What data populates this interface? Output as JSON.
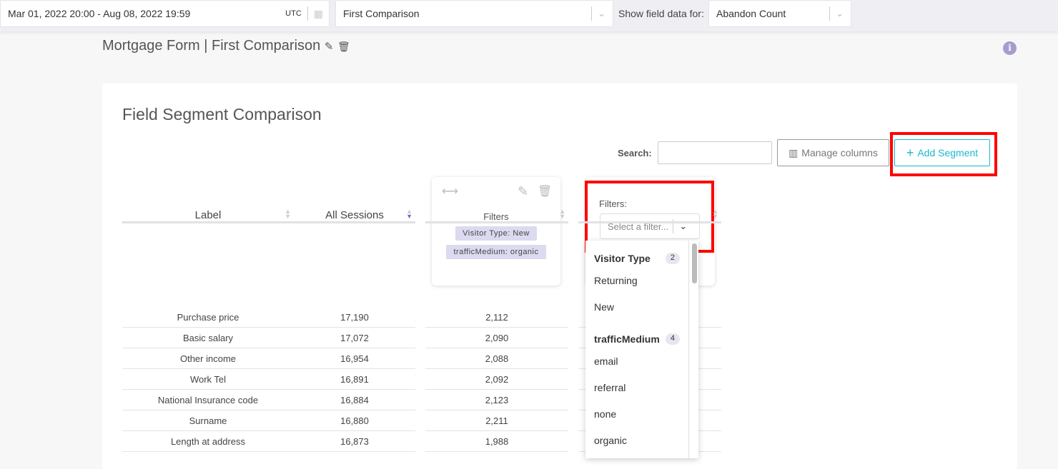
{
  "topbar": {
    "date_range": "Mar 01, 2022 20:00 - Aug 08, 2022 19:59",
    "timezone": "UTC",
    "comparison": "First Comparison",
    "field_data_label": "Show field data for:",
    "field_data_value": "Abandon Count"
  },
  "page_title": "Mortgage Form | First Comparison",
  "card": {
    "title": "Field Segment Comparison",
    "search_label": "Search:",
    "search_value": "",
    "manage_columns": "Manage columns",
    "add_segment": "Add Segment"
  },
  "segment1": {
    "filters_label": "Filters",
    "tags": [
      "Visitor Type: New",
      "trafficMedium: organic"
    ]
  },
  "segment2": {
    "filters_label": "Filters:",
    "placeholder": "Select a filter..."
  },
  "dropdown": {
    "groups": [
      {
        "name": "Visitor Type",
        "count": "2",
        "options": [
          "Returning",
          "New"
        ]
      },
      {
        "name": "trafficMedium",
        "count": "4",
        "options": [
          "email",
          "referral",
          "none",
          "organic"
        ]
      }
    ]
  },
  "table": {
    "headers": [
      "Label",
      "All Sessions"
    ],
    "rows": [
      {
        "label": "Purchase price",
        "all": "17,190",
        "seg1": "2,112"
      },
      {
        "label": "Basic salary",
        "all": "17,072",
        "seg1": "2,090"
      },
      {
        "label": "Other income",
        "all": "16,954",
        "seg1": "2,088"
      },
      {
        "label": "Work Tel",
        "all": "16,891",
        "seg1": "2,092"
      },
      {
        "label": "National Insurance code",
        "all": "16,884",
        "seg1": "2,123"
      },
      {
        "label": "Surname",
        "all": "16,880",
        "seg1": "2,211"
      },
      {
        "label": "Length at address",
        "all": "16,873",
        "seg1": "1,988"
      }
    ]
  }
}
